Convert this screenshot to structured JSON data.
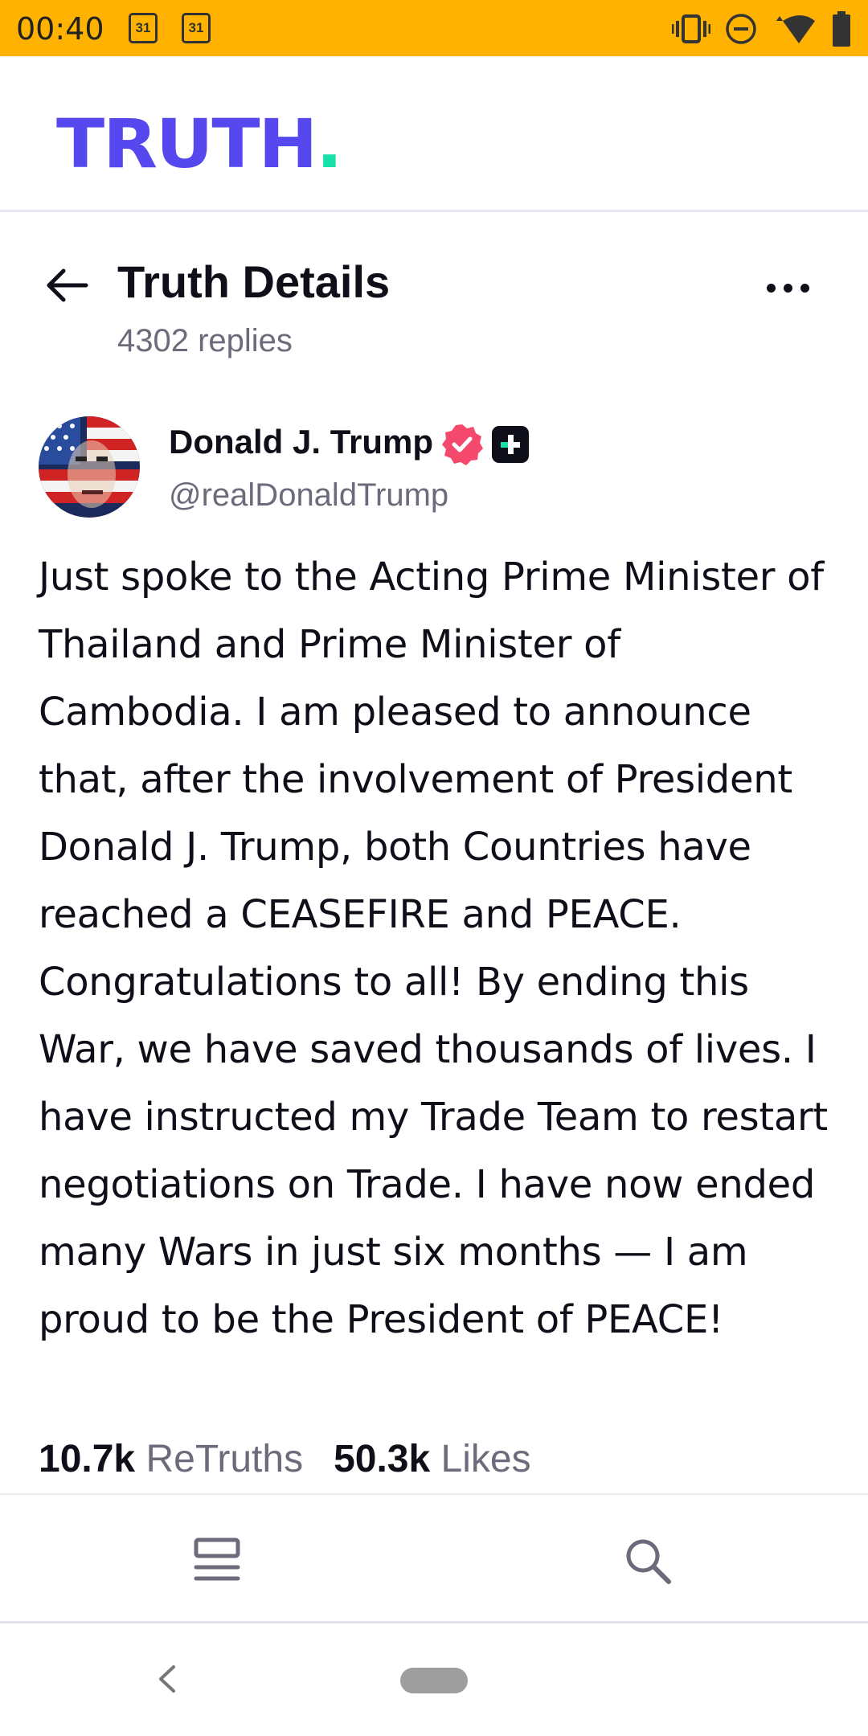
{
  "status_bar": {
    "time": "00:40",
    "calendar_day_1": "31",
    "calendar_day_2": "31",
    "icons": [
      "vibrate-icon",
      "do-not-disturb-icon",
      "wifi-icon",
      "battery-icon"
    ]
  },
  "app": {
    "logo_text": "TRUTH",
    "logo_dot": ".",
    "brand_color": "#5448ee",
    "accent_color": "#17e1a8"
  },
  "details": {
    "title": "Truth Details",
    "replies": "4302 replies"
  },
  "post": {
    "author_name": "Donald J. Trump",
    "author_handle": "@realDonaldTrump",
    "body": "Just spoke to the Acting Prime Minister of Thailand and Prime Minister of Cambodia. I am pleased to announce that, after the involvement of President Donald J. Trump, both Countries have reached a CEASEFIRE and PEACE. Congratulations to all! By ending this War, we have saved thousands of lives. I have instructed my Trade Team to restart negotiations on Trade. I have now ended many Wars in just six months — I am proud to be the President of PEACE!",
    "retruths_count": "10.7k",
    "retruths_label": "ReTruths",
    "likes_count": "50.3k",
    "likes_label": "Likes",
    "verified_color": "#f5486d"
  },
  "tab_bar": {
    "items": [
      "feed-icon",
      "search-icon"
    ]
  }
}
